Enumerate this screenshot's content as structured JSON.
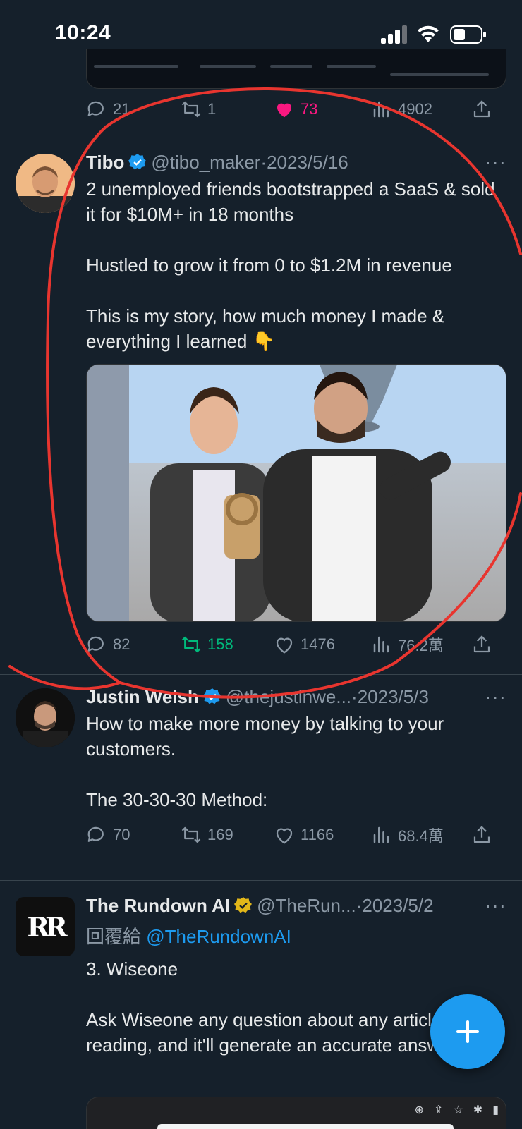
{
  "status_bar": {
    "time": "10:24"
  },
  "prev_tweet": {
    "actions": {
      "replies": "21",
      "retweets": "1",
      "likes": "73",
      "views": "4902"
    }
  },
  "tweets": [
    {
      "name": "Tibo",
      "handle": "@tibo_maker",
      "dot": "·",
      "date": "2023/5/16",
      "text": "2 unemployed friends bootstrapped a SaaS & sold it for $10M+ in 18 months\n\nHustled to grow it from 0 to $1.2M in revenue\n\nThis is my story, how much money I made & everything I learned 👇",
      "actions": {
        "replies": "82",
        "retweets": "158",
        "likes": "1476",
        "views": "76.2萬"
      }
    },
    {
      "name": "Justin Welsh",
      "handle": "@thejustinwe...",
      "dot": "·",
      "date": "2023/5/3",
      "text": "How to make more money by talking to your customers.\n\nThe 30-30-30 Method:",
      "actions": {
        "replies": "70",
        "retweets": "169",
        "likes": "1166",
        "views": "68.4萬"
      }
    },
    {
      "name": "The Rundown AI",
      "handle": "@TheRun...",
      "dot": "·",
      "date": "2023/5/2",
      "replying_prefix": "回覆給 ",
      "replying_to": "@TheRundownAI",
      "text": "3. Wiseone\n\nAsk Wiseone any question about any article you're reading, and it'll generate an accurate answer.",
      "logo_text": "RR"
    }
  ],
  "more_label": "···",
  "colors": {
    "background": "#15202b",
    "accent": "#1d9bf0",
    "like": "#f91880",
    "retweet": "#00ba7c",
    "annotation": "#e8352f"
  },
  "icons": [
    "reply-icon",
    "retweet-icon",
    "like-icon",
    "views-icon",
    "share-icon",
    "verified-icon",
    "compose-icon"
  ]
}
